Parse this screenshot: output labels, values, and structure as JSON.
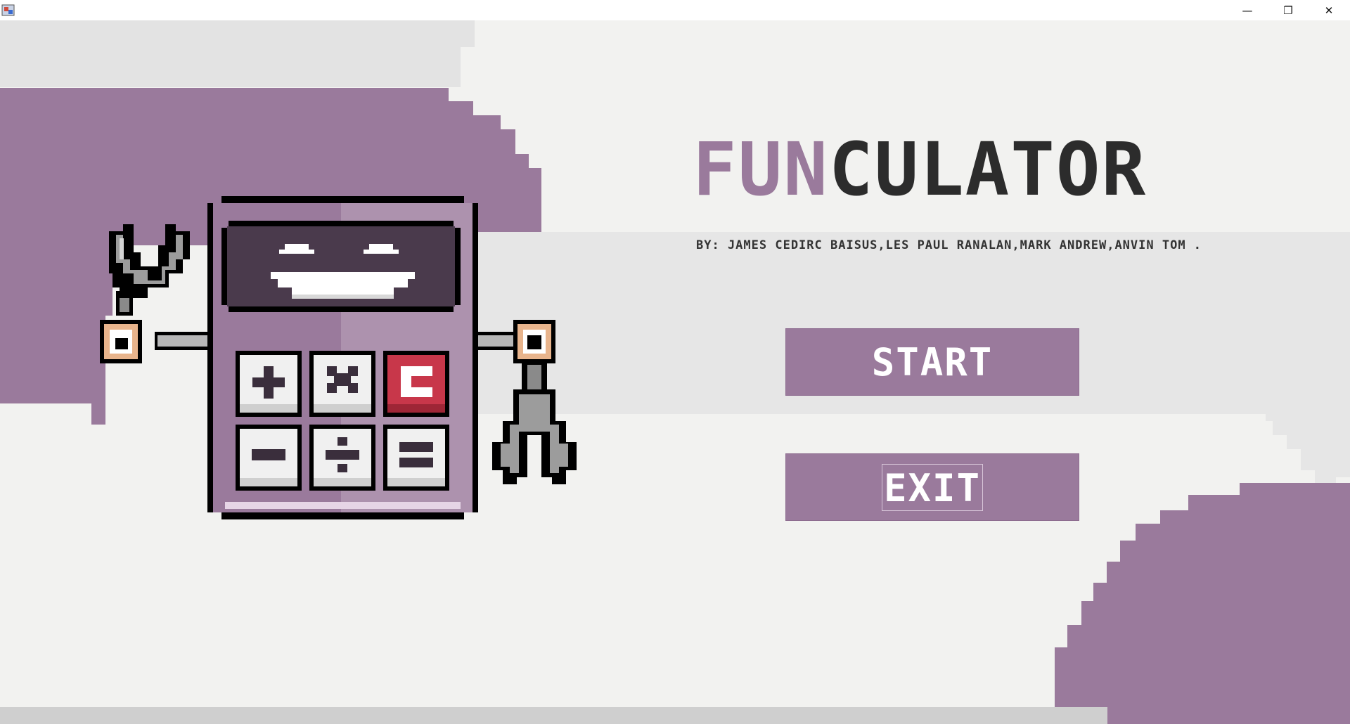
{
  "window": {
    "icon": "java-app-icon",
    "controls": {
      "minimize": "—",
      "maximize": "❐",
      "close": "✕"
    }
  },
  "title": {
    "part1": "FUN",
    "part2": "CULATOR"
  },
  "credits": "BY: JAMES CEDIRC BAISUS,LES PAUL RANALAN,MARK ANDREW,ANVIN TOM  .",
  "buttons": {
    "start": "START",
    "exit": "EXIT"
  },
  "mascot": {
    "keys": [
      "+",
      "×",
      "C",
      "−",
      "÷",
      "="
    ]
  },
  "colors": {
    "purple": "#9a7a9c",
    "dark": "#2c2c2c",
    "bg": "#f2f2f0",
    "red_key": "#c8374a"
  }
}
